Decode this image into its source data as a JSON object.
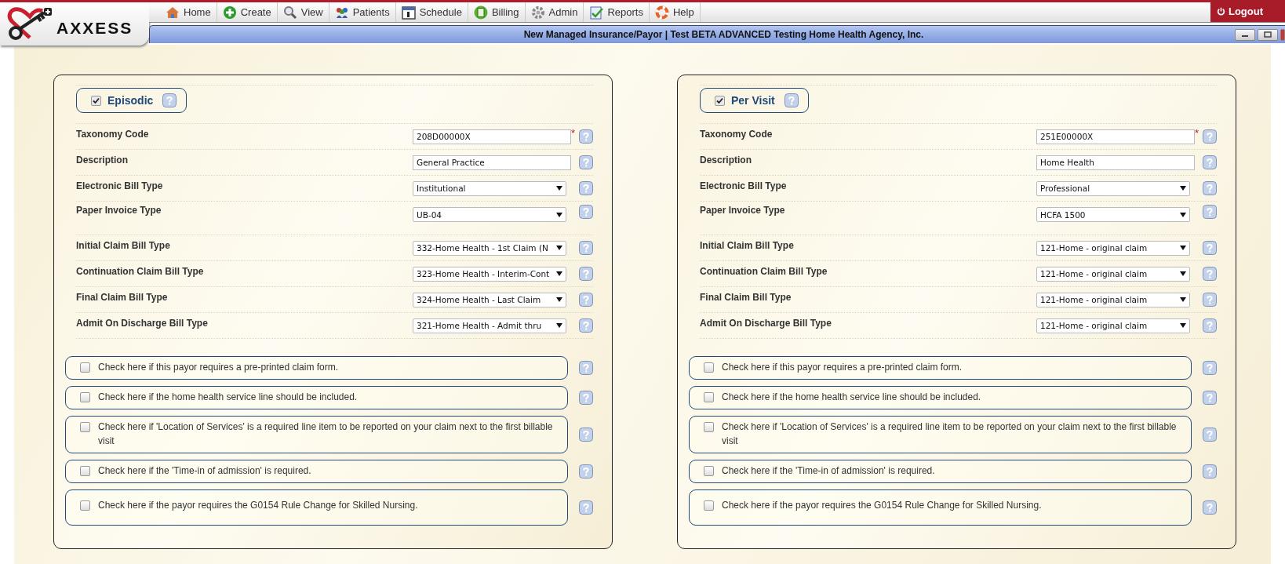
{
  "logo": {
    "text": "AXXESS"
  },
  "nav": [
    {
      "label": "Home"
    },
    {
      "label": "Create"
    },
    {
      "label": "View"
    },
    {
      "label": "Patients"
    },
    {
      "label": "Schedule"
    },
    {
      "label": "Billing"
    },
    {
      "label": "Admin"
    },
    {
      "label": "Reports"
    },
    {
      "label": "Help"
    }
  ],
  "logout": {
    "label": "Logout"
  },
  "window": {
    "title": "New Managed Insurance/Payor | Test BETA ADVANCED Testing Home Health Agency, Inc."
  },
  "panels": [
    {
      "title": "Episodic",
      "checked": true,
      "fields": [
        {
          "label": "Taxonomy Code",
          "kind": "text",
          "value": "208D00000X",
          "required_mark": "*"
        },
        {
          "label": "Description",
          "kind": "text",
          "value": "General Practice"
        },
        {
          "label": "Electronic Bill Type",
          "kind": "select",
          "value": "Institutional"
        },
        {
          "label": "Paper Invoice Type",
          "kind": "select",
          "value": "UB-04",
          "gap_after": true
        },
        {
          "label": "Initial Claim Bill Type",
          "kind": "select",
          "value": "332-Home Health - 1st Claim (N"
        },
        {
          "label": "Continuation Claim Bill Type",
          "kind": "select",
          "value": "323-Home Health - Interim-Cont"
        },
        {
          "label": "Final Claim Bill Type",
          "kind": "select",
          "value": "324-Home Health - Last Claim"
        },
        {
          "label": "Admit On Discharge Bill Type",
          "kind": "select",
          "value": "321-Home Health - Admit thru"
        }
      ],
      "options": [
        {
          "label": "Check here if this payor requires a pre-printed claim form.",
          "checked": false
        },
        {
          "label": "Check here if the home health service line should be included.",
          "checked": false
        },
        {
          "label": "Check here if 'Location of Services' is a required line item to be reported on your claim next to the first billable visit",
          "checked": false
        },
        {
          "label": "Check here if the 'Time-in of admission' is required.",
          "checked": false
        },
        {
          "label": "Check here if the payor requires the G0154 Rule Change for Skilled Nursing.",
          "checked": false,
          "tall": true
        }
      ]
    },
    {
      "title": "Per Visit",
      "checked": true,
      "fields": [
        {
          "label": "Taxonomy Code",
          "kind": "text",
          "value": "251E00000X",
          "required_mark": "*"
        },
        {
          "label": "Description",
          "kind": "text",
          "value": "Home Health"
        },
        {
          "label": "Electronic Bill Type",
          "kind": "select",
          "value": "Professional"
        },
        {
          "label": "Paper Invoice Type",
          "kind": "select",
          "value": "HCFA 1500",
          "gap_after": true
        },
        {
          "label": "Initial Claim Bill Type",
          "kind": "select",
          "value": "121-Home - original claim"
        },
        {
          "label": "Continuation Claim Bill Type",
          "kind": "select",
          "value": "121-Home - original claim"
        },
        {
          "label": "Final Claim Bill Type",
          "kind": "select",
          "value": "121-Home - original claim"
        },
        {
          "label": "Admit On Discharge Bill Type",
          "kind": "select",
          "value": "121-Home - original claim"
        }
      ],
      "options": [
        {
          "label": "Check here if this payor requires a pre-printed claim form.",
          "checked": false
        },
        {
          "label": "Check here if the home health service line should be included.",
          "checked": false
        },
        {
          "label": "Check here if 'Location of Services' is a required line item to be reported on your claim next to the first billable visit",
          "checked": false
        },
        {
          "label": "Check here if the 'Time-in of admission' is required.",
          "checked": false
        },
        {
          "label": "Check here if the payor requires the G0154 Rule Change for Skilled Nursing.",
          "checked": false,
          "tall": true
        }
      ]
    }
  ]
}
